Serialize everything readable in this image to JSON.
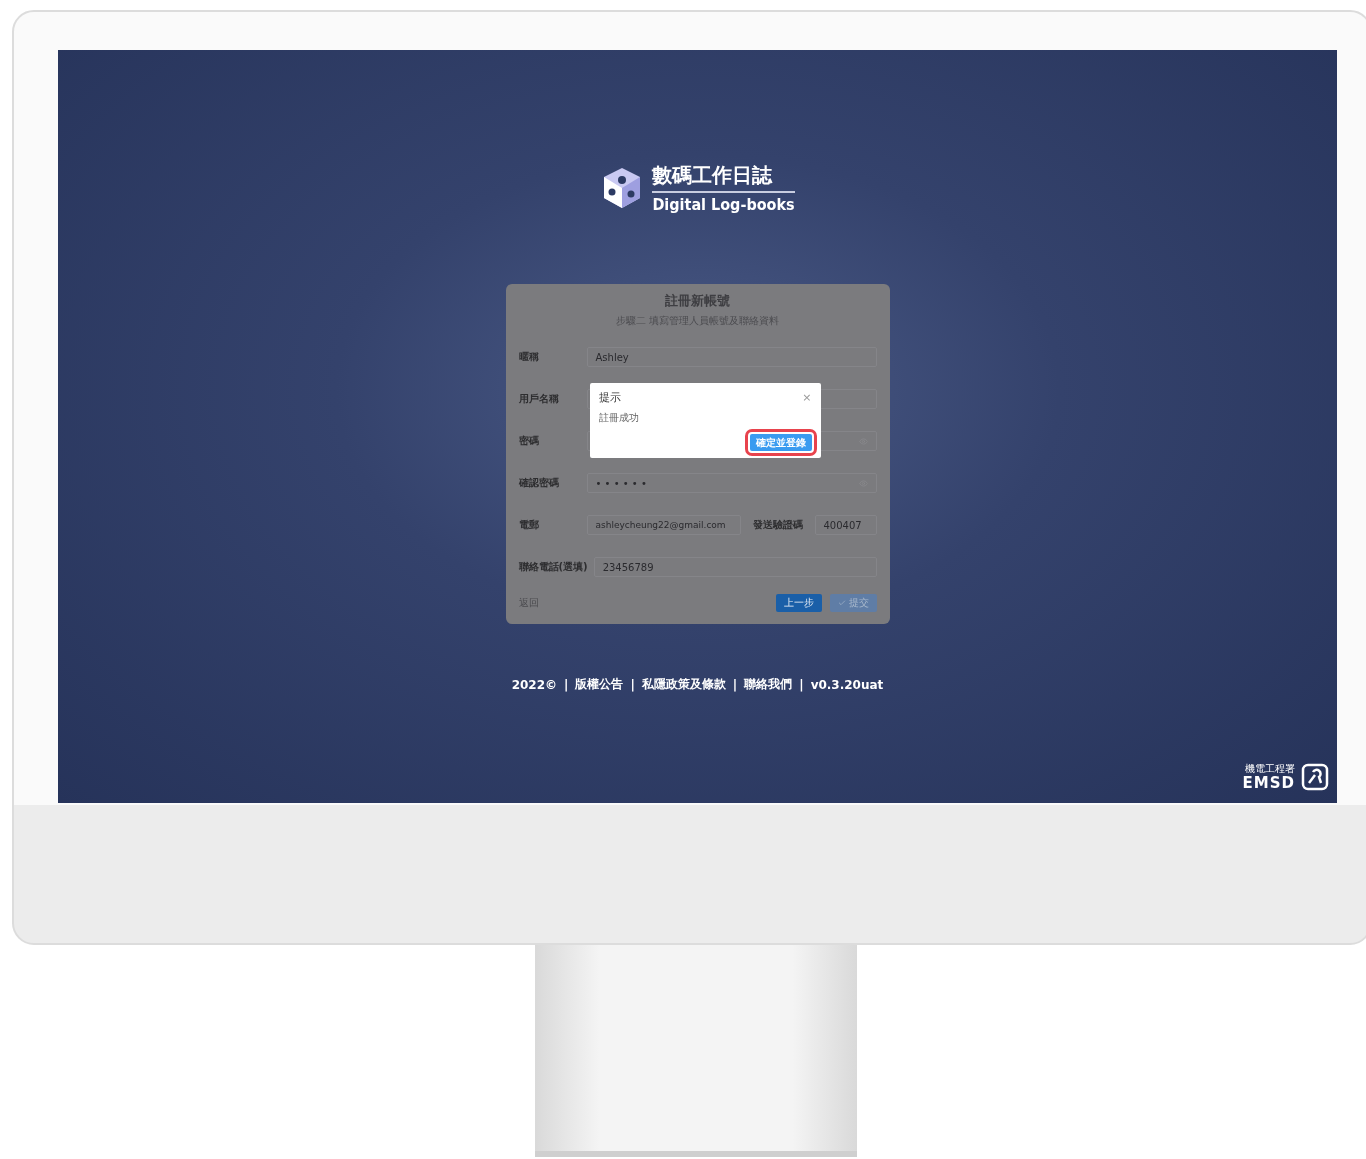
{
  "brand": {
    "title": "數碼工作日誌",
    "subtitle": "Digital Log-books"
  },
  "form": {
    "title": "註冊新帳號",
    "step": "步驟二 填寫管理人員帳號及聯絡資料",
    "fields": [
      {
        "kind": "text",
        "label": "暱稱",
        "value": "Ashley"
      },
      {
        "kind": "text",
        "label": "用戶名稱"
      },
      {
        "kind": "password",
        "label": "密碼"
      },
      {
        "kind": "password",
        "label": "確認密碼",
        "value": "• • • • • •"
      },
      {
        "kind": "email",
        "label": "電郵",
        "value": "ashleycheung22@gmail.com",
        "action": "發送驗證碼",
        "code": "400407"
      },
      {
        "kind": "text",
        "label": "聯絡電話(選填)",
        "value": "23456789"
      }
    ],
    "back_link": "返回",
    "buttons": [
      {
        "label": "上一步",
        "disabled": false,
        "icon": false
      },
      {
        "label": "提交",
        "disabled": true,
        "icon": true
      }
    ]
  },
  "dialog": {
    "title": "提示",
    "close": "×",
    "message": "註冊成功",
    "button": {
      "label": "確定並登錄",
      "highlighted": true
    }
  },
  "footer": {
    "separator": "|",
    "items": [
      "2022©",
      "版權公告",
      "私隱政策及條款",
      "聯絡我們",
      "v0.3.20uat"
    ]
  },
  "agency": {
    "name_zh": "機電工程署",
    "name_en": "EMSD"
  }
}
